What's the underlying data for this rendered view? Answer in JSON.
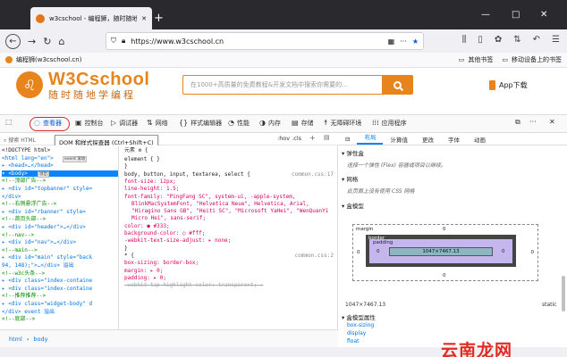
{
  "browser": {
    "tab_title": "w3cschool - 编程狮，随时随地",
    "new_tab_symbol": "+",
    "url": "https://www.w3cschool.cn",
    "bookmark_site": "编程狮(w3cschool.cn)",
    "other_bookmarks": "其他书签",
    "mobile_bookmarks": "移动设备上的书签",
    "win_min": "—",
    "win_max": "□",
    "win_close": "✕"
  },
  "site": {
    "logo_main": "W3Cschool",
    "logo_sub": "随时随地学编程",
    "search_placeholder": "在1000+高质量的免费教程&开发文档中搜索你需要的...",
    "app_download": "App下载"
  },
  "devtools": {
    "tabs": [
      {
        "icon": "inspector-icon",
        "label": "查看器"
      },
      {
        "icon": "console-icon",
        "label": "控制台"
      },
      {
        "icon": "debugger-icon",
        "label": "调试器"
      },
      {
        "icon": "network-icon",
        "label": "网络"
      },
      {
        "icon": "style-editor-icon",
        "label": "样式编辑器"
      },
      {
        "icon": "performance-icon",
        "label": "性能"
      },
      {
        "icon": "memory-icon",
        "label": "内存"
      },
      {
        "icon": "storage-icon",
        "label": "存储"
      },
      {
        "icon": "accessibility-icon",
        "label": "无障碍环境"
      },
      {
        "icon": "application-icon",
        "label": "应用程序"
      }
    ],
    "search_html_placeholder": "搜索 HTML",
    "tooltip": "DOM 和样式探查器 (Ctrl+Shift+C)",
    "rules_filter": ":hov .cls",
    "element_label": "元素 ⚙ {",
    "layout_tabs": [
      "布局",
      "计算值",
      "更改",
      "字体",
      "动画"
    ],
    "flexbox_title": "弹性盒",
    "flexbox_note": "选择一个弹性 (Flex) 容器或项目以继续。",
    "grid_title": "网格",
    "grid_note": "此页面上没有使用 CSS 网格",
    "boxmodel_title": "盒模型",
    "boxmodel": {
      "margin_label": "margin",
      "border_label": "border",
      "padding_label": "padding",
      "content": "1047×7467.13",
      "zero": "0"
    },
    "dimensions": "1047×7467.13",
    "position": "static",
    "boxmodel_props_title": "盒模型属性",
    "props": [
      "box-sizing",
      "display",
      "float"
    ],
    "breadcrumbs": [
      "html",
      "body"
    ],
    "html_lines": [
      {
        "text": "<!DOCTYPE html>",
        "kind": "plain"
      },
      {
        "text": "<html lang=\"en\">",
        "kind": "tag",
        "badge": "event 滚动"
      },
      {
        "text": "▸ <head>…</head>",
        "kind": "tag"
      },
      {
        "text": "▾ <body>",
        "kind": "selected",
        "badge": "溢出"
      },
      {
        "text": "  <!--顶部广告-->",
        "kind": "comment"
      },
      {
        "text": "  ▸ <div id=\"topbanner\" style=",
        "kind": "tag"
      },
      {
        "text": "    </div>",
        "kind": "tag"
      },
      {
        "text": "  <!--右侧悬浮广告-->",
        "kind": "comment"
      },
      {
        "text": "  ▸ <div id=\"rbanner\" style=",
        "kind": "tag"
      },
      {
        "text": "  <!--首页头部-->",
        "kind": "comment"
      },
      {
        "text": "  ▸ <div id=\"header\">…</div>",
        "kind": "tag"
      },
      {
        "text": "  <!--nav-->",
        "kind": "comment"
      },
      {
        "text": "  ▸ <div id=\"nav\">…</div>",
        "kind": "tag"
      },
      {
        "text": "  <!--main-->",
        "kind": "comment"
      },
      {
        "text": "  ▸ <div id=\"main\" style=\"back",
        "kind": "tag"
      },
      {
        "text": "    94, 148);\">…</div> 溢出",
        "kind": "tag"
      },
      {
        "text": "  <!--w3c头条-->",
        "kind": "comment"
      },
      {
        "text": "  ▸ <div class=\"index-containe",
        "kind": "tag"
      },
      {
        "text": "  ▸ <div class=\"index-containe",
        "kind": "tag"
      },
      {
        "text": "  <!--推荐推荐-->",
        "kind": "comment"
      },
      {
        "text": "  ▸ <div class=\"widget-body\" d",
        "kind": "tag"
      },
      {
        "text": "    </div> event 溢出",
        "kind": "tag"
      },
      {
        "text": "  <!--底部-->",
        "kind": "comment"
      }
    ],
    "css_lines": [
      {
        "text": "element { }",
        "kind": "sel"
      },
      {
        "text": "}",
        "kind": "plain"
      },
      {
        "text": "body, button, input, textarea, select {",
        "kind": "sel",
        "src": "common.css:17"
      },
      {
        "text": "  font-size: 12px;",
        "kind": "decl"
      },
      {
        "text": "  line-height: 1.5;",
        "kind": "decl"
      },
      {
        "text": "  font-family: \"PingFang SC\", system-ui, -apple-system,",
        "kind": "decl"
      },
      {
        "text": "      BlinkMacSystemFont, \"Helvetica Neue\", Helvetica, Arial,",
        "kind": "cont"
      },
      {
        "text": "    \"Hiragino Sans GB\", \"Heiti SC\", \"Microsoft YaHei\", \"WenQuanYi",
        "kind": "cont"
      },
      {
        "text": "    Micro Hei\", sans-serif;",
        "kind": "cont"
      },
      {
        "text": "  color: ● #333;",
        "kind": "decl"
      },
      {
        "text": "  background-color: ○ #fff;",
        "kind": "decl"
      },
      {
        "text": "  -webkit-text-size-adjust: ▸ none;",
        "kind": "decl"
      },
      {
        "text": "}",
        "kind": "plain"
      },
      {
        "text": "* {",
        "kind": "sel",
        "src": "common.css:2"
      },
      {
        "text": "  box-sizing: border-box;",
        "kind": "decl"
      },
      {
        "text": "  margin: ▸ 0;",
        "kind": "decl"
      },
      {
        "text": "  padding: ▸ 0;",
        "kind": "decl"
      },
      {
        "text": "  -webkit-tap-highlight-color: transparent; ⚠",
        "kind": "strike"
      }
    ]
  },
  "watermark": "云南龙网"
}
